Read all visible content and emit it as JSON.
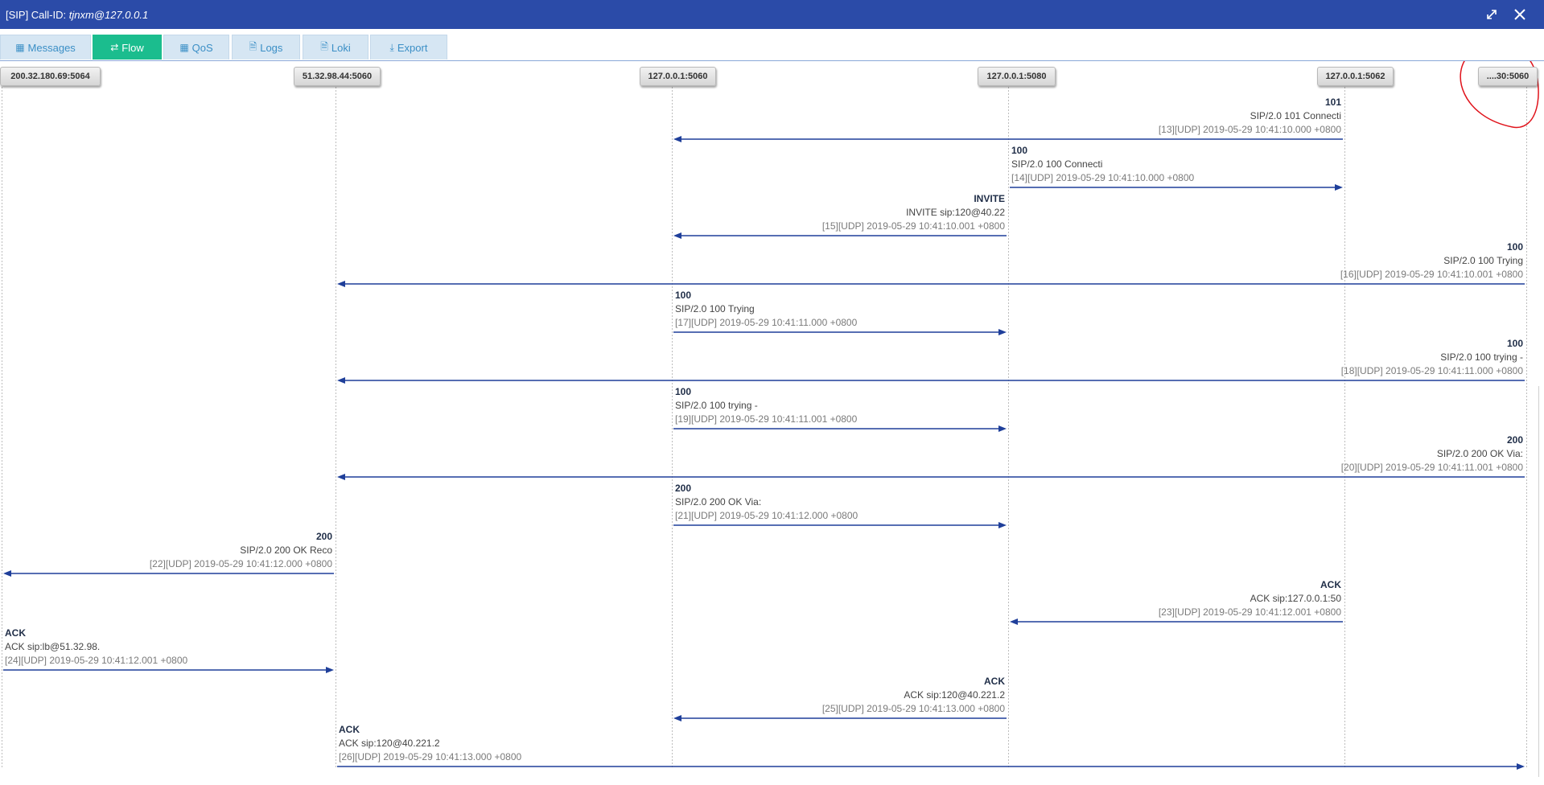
{
  "window": {
    "title_prefix": "[SIP] Call-ID: ",
    "call_id": "tjnxm@127.0.0.1"
  },
  "tabs": [
    {
      "key": "messages",
      "label": "Messages",
      "icon": "grid-icon",
      "glyph": "▦",
      "active": false
    },
    {
      "key": "flow",
      "label": "Flow",
      "icon": "flow-arrows-icon",
      "glyph": "⇄",
      "active": true
    },
    {
      "key": "qos",
      "label": "QoS",
      "icon": "grid-icon",
      "glyph": "▦",
      "active": false
    },
    {
      "key": "logs",
      "label": "Logs",
      "icon": "document-icon",
      "glyph": "🗎",
      "active": false
    },
    {
      "key": "loki",
      "label": "Loki",
      "icon": "document-icon",
      "glyph": "🗎",
      "active": false
    },
    {
      "key": "export",
      "label": "Export",
      "icon": "download-icon",
      "glyph": "⤓",
      "active": false
    }
  ],
  "hosts": [
    {
      "label": "200.32.180.69:5064"
    },
    {
      "label": "51.32.98.44:5060"
    },
    {
      "label": "127.0.0.1:5060"
    },
    {
      "label": "127.0.0.1:5080"
    },
    {
      "label": "127.0.0.1:5062"
    },
    {
      "label": "....30:5060"
    }
  ],
  "messages": [
    {
      "from": 4,
      "to": 2,
      "method": "101",
      "summary": "SIP/2.0 101 Connecti",
      "detail": "[13][UDP] 2019-05-29 10:41:10.000 +0800"
    },
    {
      "from": 3,
      "to": 4,
      "method": "100",
      "summary": "SIP/2.0 100 Connecti",
      "detail": "[14][UDP] 2019-05-29 10:41:10.000 +0800"
    },
    {
      "from": 3,
      "to": 2,
      "method": "INVITE",
      "summary": "INVITE sip:120@40.22",
      "detail": "[15][UDP] 2019-05-29 10:41:10.001 +0800"
    },
    {
      "from": 5,
      "to": 1,
      "method": "100",
      "summary": "SIP/2.0 100 Trying",
      "detail": "[16][UDP] 2019-05-29 10:41:10.001 +0800"
    },
    {
      "from": 2,
      "to": 3,
      "method": "100",
      "summary": "SIP/2.0 100 Trying",
      "detail": "[17][UDP] 2019-05-29 10:41:11.000 +0800"
    },
    {
      "from": 5,
      "to": 1,
      "method": "100",
      "summary": "SIP/2.0 100 trying -",
      "detail": "[18][UDP] 2019-05-29 10:41:11.000 +0800"
    },
    {
      "from": 2,
      "to": 3,
      "method": "100",
      "summary": "SIP/2.0 100 trying -",
      "detail": "[19][UDP] 2019-05-29 10:41:11.001 +0800"
    },
    {
      "from": 5,
      "to": 1,
      "method": "200",
      "summary": "SIP/2.0 200 OK Via:",
      "detail": "[20][UDP] 2019-05-29 10:41:11.001 +0800"
    },
    {
      "from": 2,
      "to": 3,
      "method": "200",
      "summary": "SIP/2.0 200 OK Via:",
      "detail": "[21][UDP] 2019-05-29 10:41:12.000 +0800"
    },
    {
      "from": 1,
      "to": 0,
      "method": "200",
      "summary": "SIP/2.0 200 OK Reco",
      "detail": "[22][UDP] 2019-05-29 10:41:12.000 +0800"
    },
    {
      "from": 4,
      "to": 3,
      "method": "ACK",
      "summary": "ACK sip:127.0.0.1:50",
      "detail": "[23][UDP] 2019-05-29 10:41:12.001 +0800"
    },
    {
      "from": 0,
      "to": 1,
      "method": "ACK",
      "summary": "ACK sip:lb@51.32.98.",
      "detail": "[24][UDP] 2019-05-29 10:41:12.001 +0800"
    },
    {
      "from": 3,
      "to": 2,
      "method": "ACK",
      "summary": "ACK sip:120@40.221.2",
      "detail": "[25][UDP] 2019-05-29 10:41:13.000 +0800"
    },
    {
      "from": 1,
      "to": 5,
      "method": "ACK",
      "summary": "ACK sip:120@40.221.2",
      "detail": "[26][UDP] 2019-05-29 10:41:13.000 +0800"
    }
  ],
  "colors": {
    "titlebar": "#2b4ba8",
    "tab_active": "#1bbd8e",
    "tab_inactive": "#d6e6f3",
    "arrow": "#1f3f9a",
    "lifeline": "#bdbdbd",
    "annotation": "#e0131b"
  }
}
